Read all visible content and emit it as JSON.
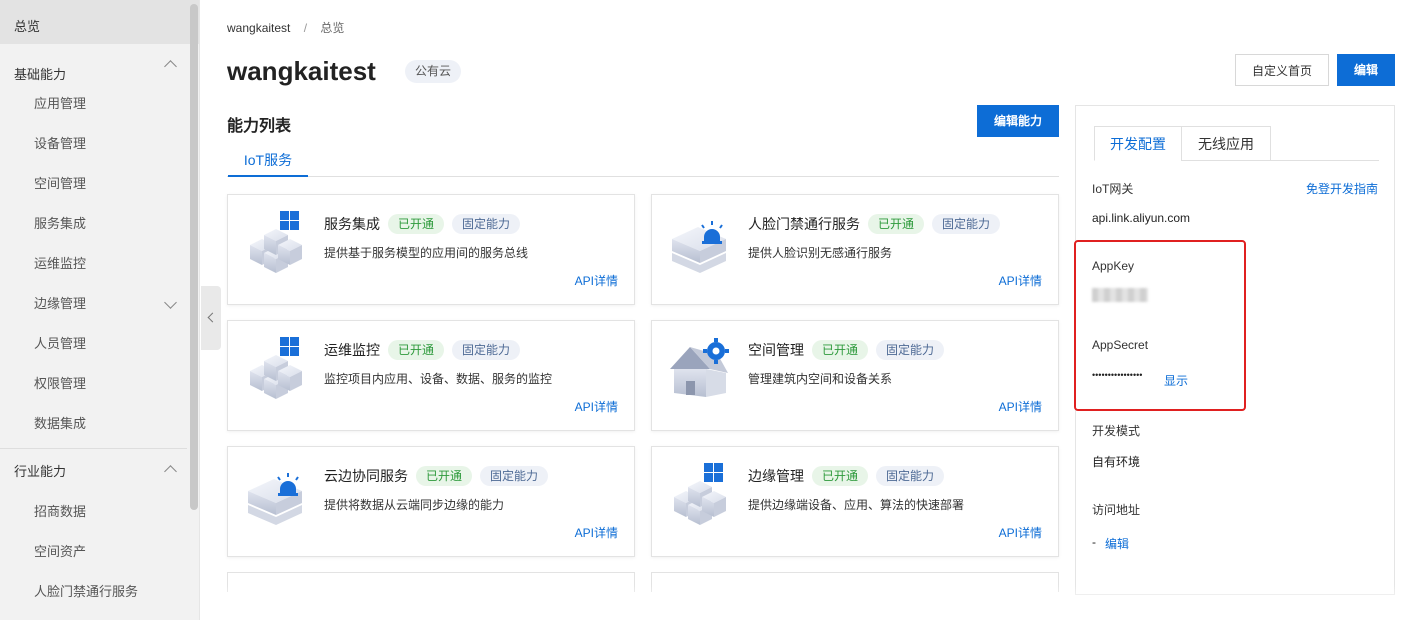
{
  "sidebar": {
    "top": "总览",
    "groups": [
      {
        "label": "基础能力",
        "items": [
          "应用管理",
          "设备管理",
          "空间管理",
          "服务集成",
          "运维监控",
          "边缘管理",
          "人员管理",
          "权限管理",
          "数据集成"
        ]
      },
      {
        "label": "行业能力",
        "items": [
          "招商数据",
          "空间资产",
          "人脸门禁通行服务"
        ]
      }
    ]
  },
  "breadcrumb": {
    "project": "wangkaitest",
    "separator": "/",
    "current": "总览"
  },
  "header": {
    "title": "wangkaitest",
    "tag": "公有云",
    "custom_home_label": "自定义首页",
    "edit_label": "编辑"
  },
  "capabilities": {
    "title": "能力列表",
    "edit_label": "编辑能力",
    "tab": "IoT服务",
    "cards": [
      {
        "title": "服务集成",
        "status": "已开通",
        "type": "固定能力",
        "desc": "提供基于服务模型的应用间的服务总线",
        "api": "API详情",
        "icon": "cubes-icon"
      },
      {
        "title": "人脸门禁通行服务",
        "status": "已开通",
        "type": "固定能力",
        "desc": "提供人脸识别无感通行服务",
        "api": "API详情",
        "icon": "server-alarm-icon"
      },
      {
        "title": "运维监控",
        "status": "已开通",
        "type": "固定能力",
        "desc": "监控项目内应用、设备、数据、服务的监控",
        "api": "API详情",
        "icon": "cubes-icon"
      },
      {
        "title": "空间管理",
        "status": "已开通",
        "type": "固定能力",
        "desc": "管理建筑内空间和设备关系",
        "api": "API详情",
        "icon": "house-gear-icon"
      },
      {
        "title": "云边协同服务",
        "status": "已开通",
        "type": "固定能力",
        "desc": "提供将数据从云端同步边缘的能力",
        "api": "API详情",
        "icon": "server-alarm-icon"
      },
      {
        "title": "边缘管理",
        "status": "已开通",
        "type": "固定能力",
        "desc": "提供边缘端设备、应用、算法的快速部署",
        "api": "API详情",
        "icon": "cubes-icon"
      }
    ]
  },
  "dev_panel": {
    "tabs": [
      "开发配置",
      "无线应用"
    ],
    "gateway_label": "IoT网关",
    "guide_link": "免登开发指南",
    "gateway_value": "api.link.aliyun.com",
    "appkey_label": "AppKey",
    "appsecret_label": "AppSecret",
    "appsecret_mask": "••••••••••••••••",
    "show_label": "显示",
    "mode_label": "开发模式",
    "mode_value": "自有环境",
    "address_label": "访问地址",
    "address_dash": "-",
    "address_edit": "编辑"
  },
  "colors": {
    "primary": "#0d6dd6",
    "success": "#2e9a3c",
    "highlight": "#e02020"
  }
}
